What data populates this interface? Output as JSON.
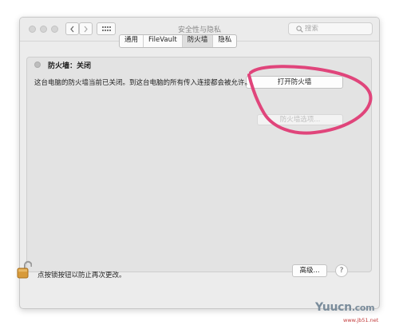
{
  "window": {
    "title": "安全性与隐私",
    "search_placeholder": "搜索"
  },
  "tabs": [
    {
      "label": "通用"
    },
    {
      "label": "FileVault"
    },
    {
      "label": "防火墙"
    },
    {
      "label": "隐私"
    }
  ],
  "firewall": {
    "status_label": "防火墙：关闭",
    "turn_on_button": "打开防火墙",
    "description": "这台电脑的防火墙当前已关闭。到这台电脑的所有传入连接都会被允许。",
    "options_button": "防火墙选项..."
  },
  "footer": {
    "lock_label": "点按锁按钮以防止再次更改。",
    "advanced_button": "高级...",
    "help_button": "?"
  },
  "annotation": {
    "color": "#e0457b"
  },
  "watermark": {
    "brand": "Yuucn",
    "com": ".com",
    "site": "www.jb51.net"
  },
  "icons": {
    "back": "chevron-left-icon",
    "forward": "chevron-right-icon",
    "grid": "grid-icon",
    "search": "magnifier-icon",
    "lock": "unlocked-padlock-icon"
  }
}
